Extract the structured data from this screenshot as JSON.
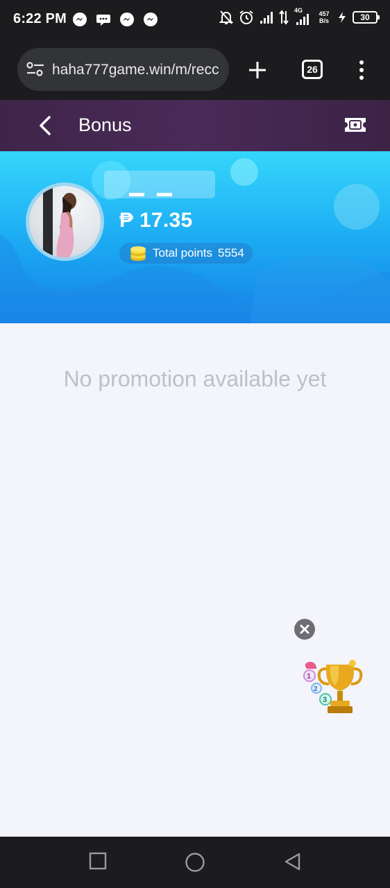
{
  "status_bar": {
    "time": "6:22 PM",
    "network_type": "4G",
    "net_speed_value": "457",
    "net_speed_unit": "B/s",
    "battery": "30",
    "notification_icons": [
      "messenger-icon",
      "chat-bubble-icon",
      "messenger-icon",
      "messenger-icon"
    ],
    "system_icons": [
      "bell-off-icon",
      "alarm-icon",
      "signal-icon",
      "data-arrows-icon",
      "signal-4g-icon",
      "charging-icon",
      "battery-icon"
    ]
  },
  "browser": {
    "url": "haha777game.win/m/recc",
    "tab_count": "26",
    "icons": [
      "site-settings-icon",
      "plus-icon",
      "tabs-icon",
      "more-vert-icon"
    ]
  },
  "header": {
    "title": "Bonus",
    "icons": [
      "back-chevron-icon",
      "ticket-icon"
    ]
  },
  "profile": {
    "balance": "₱ 17.35",
    "points_label": "Total points",
    "points_value": "5554"
  },
  "content": {
    "empty_message": "No promotion available yet"
  },
  "floating": {
    "icons": [
      "close-icon",
      "trophy-icon"
    ]
  },
  "navigation": {
    "icons": [
      "recents-square-icon",
      "home-circle-icon",
      "back-triangle-icon"
    ]
  },
  "colors": {
    "header_bg": "#4a2a57",
    "banner_top": "#35d6fb",
    "banner_bottom": "#1681e5",
    "content_bg": "#f4f4fb",
    "empty_text": "#bfbfc7",
    "system_bar": "#1c1c1e"
  }
}
